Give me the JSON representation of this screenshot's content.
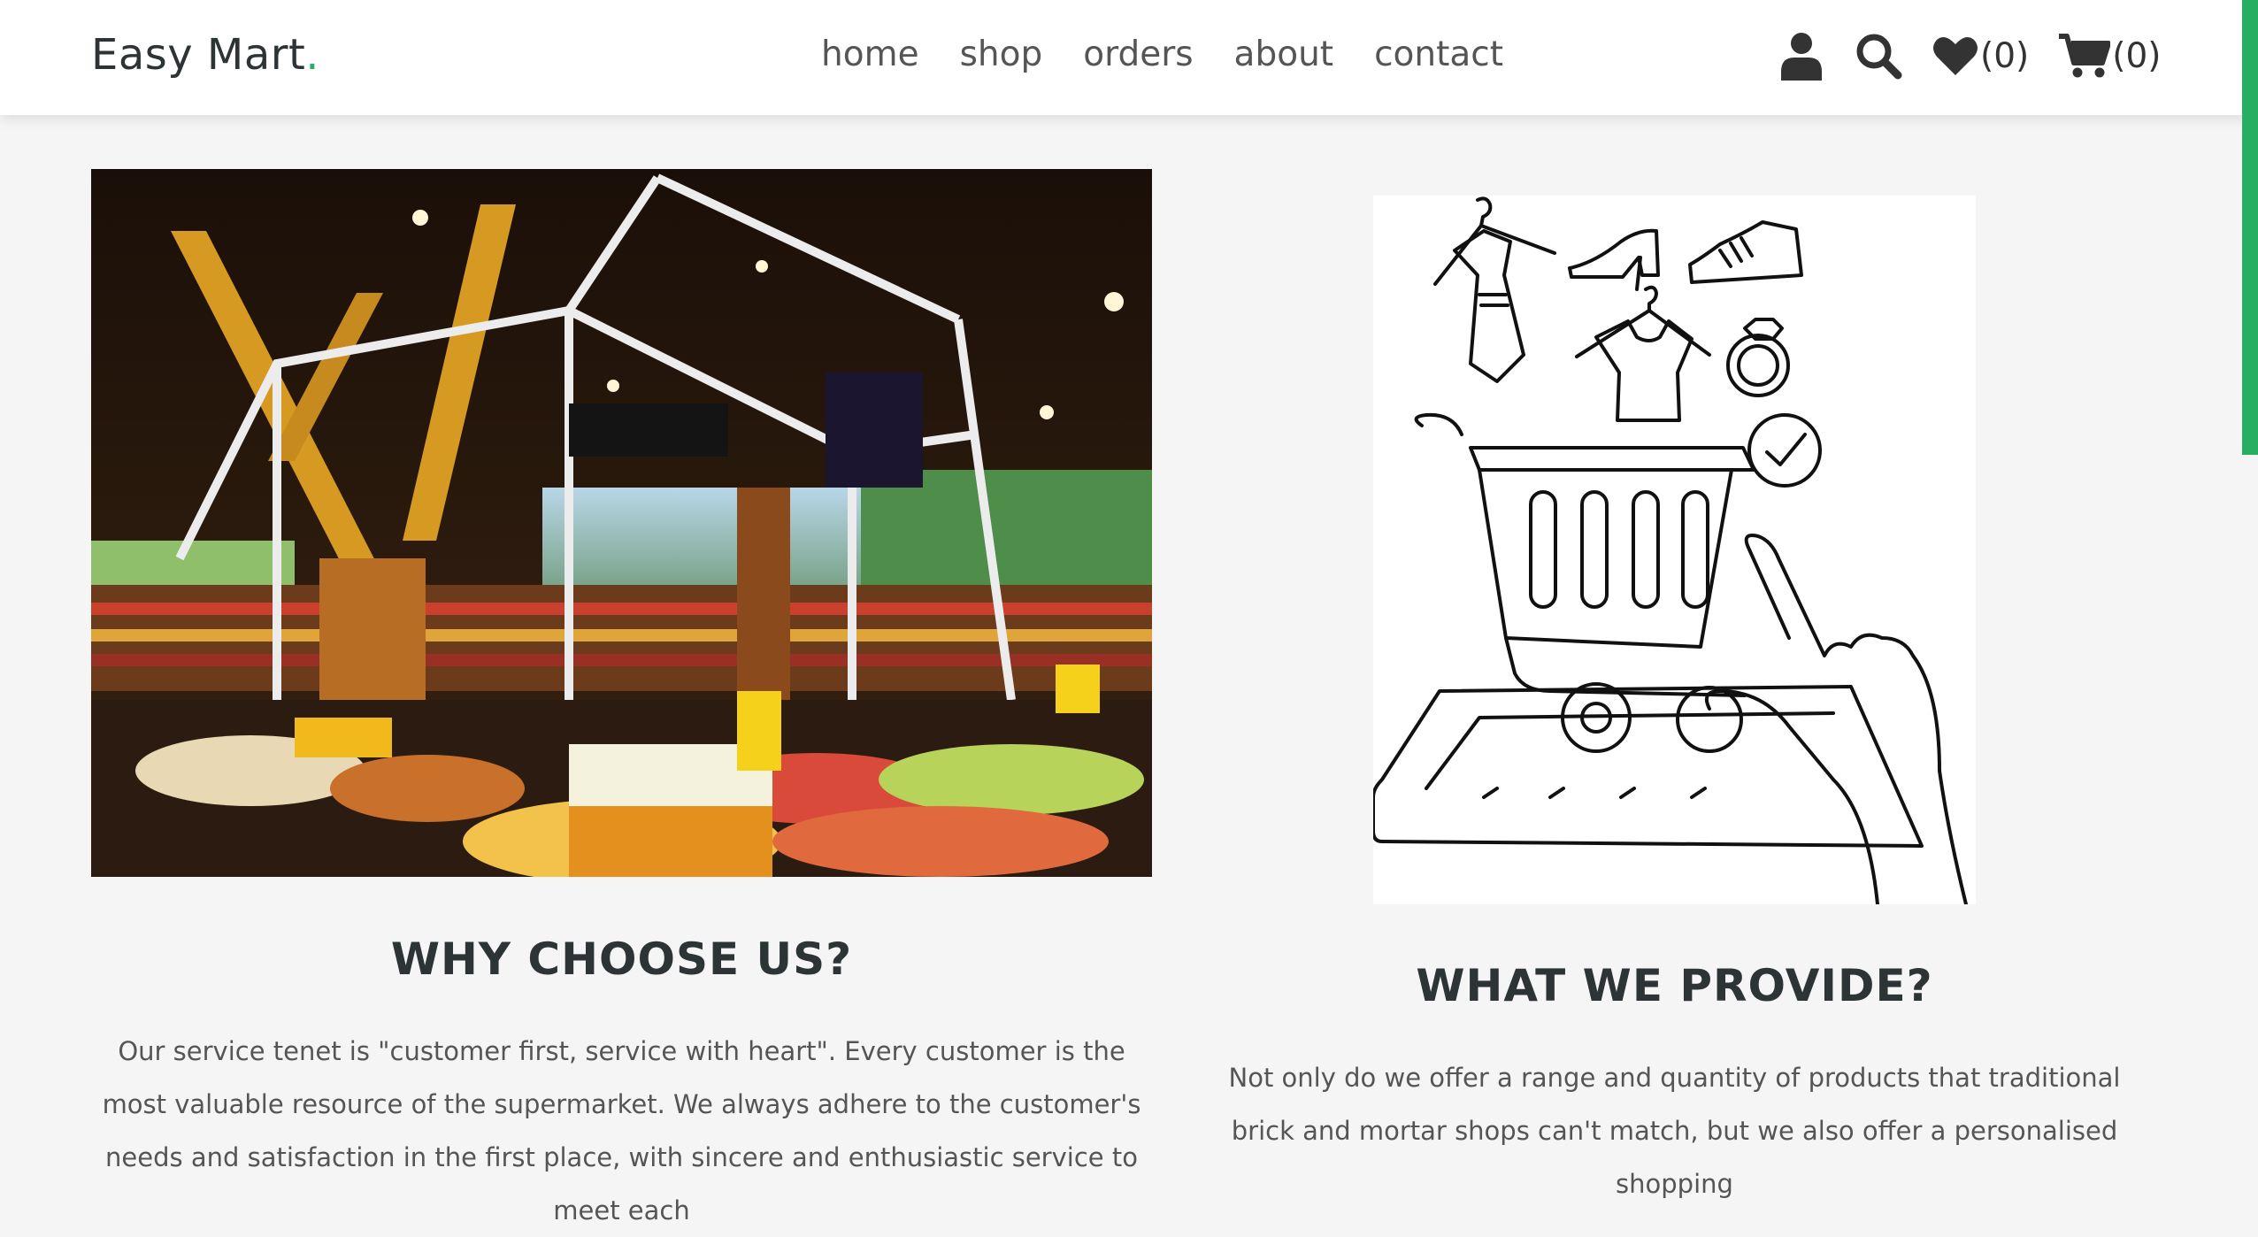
{
  "header": {
    "logo_text": "Easy Mart",
    "logo_dot": ".",
    "nav": {
      "home": "home",
      "shop": "shop",
      "orders": "orders",
      "about": "about",
      "contact": "contact"
    },
    "icons": {
      "user": "user-icon",
      "search": "search-icon",
      "wishlist": "heart-icon",
      "cart": "cart-icon"
    },
    "wishlist_count": "(0)",
    "cart_count": "(0)"
  },
  "sections": {
    "why": {
      "title": "WHY CHOOSE US?",
      "text": "Our service tenet is \"customer first, service with heart\". Every customer is the most valuable resource of the supermarket. We always adhere to the customer's needs and satisfaction in the first place, with sincere and enthusiastic service to meet each"
    },
    "provide": {
      "title": "WHAT WE PROVIDE?",
      "text": "Not only do we offer a range and quantity of products that traditional brick and mortar shops can't match, but we also offer a personalised shopping"
    }
  },
  "colors": {
    "accent": "#27ae60",
    "text_dark": "#2d3436",
    "text_body": "#555555",
    "background": "#f5f5f5"
  }
}
